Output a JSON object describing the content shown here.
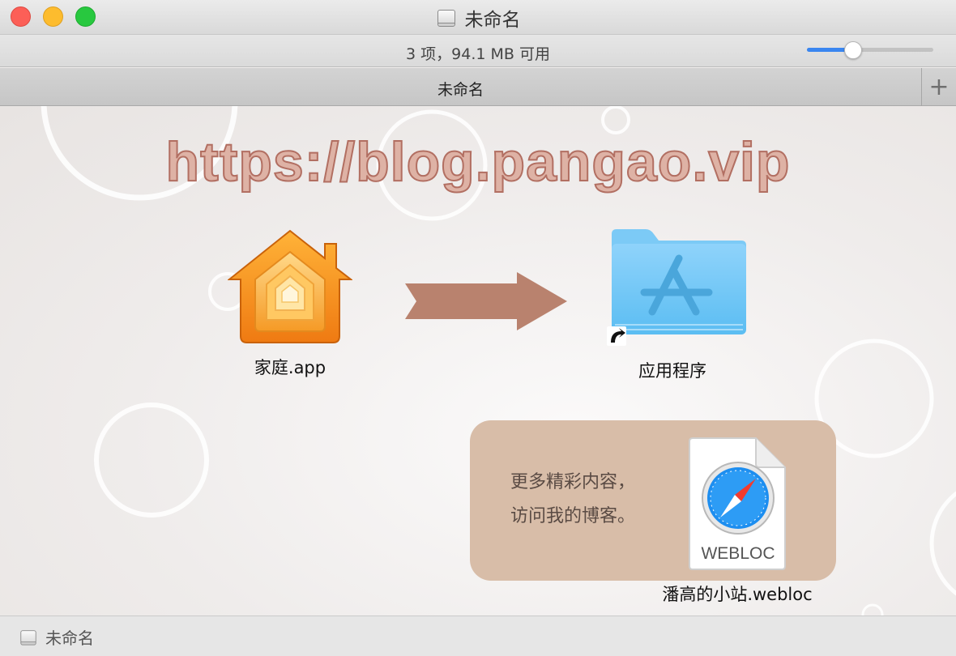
{
  "window": {
    "title": "未命名",
    "status": "3 项，94.1 MB 可用",
    "icon_size_level": 0.34
  },
  "tabs": [
    {
      "label": "未命名"
    }
  ],
  "tab_add": "+",
  "content": {
    "watermark": "https://blog.pangao.vip",
    "items": [
      {
        "name": "家庭.app",
        "icon": "home-app-icon"
      },
      {
        "name": "应用程序",
        "icon": "applications-folder-icon"
      },
      {
        "name": "潘高的小站.webloc",
        "icon": "webloc-file-icon",
        "badge": "WEBLOC"
      }
    ],
    "promo": {
      "line1": "更多精彩内容，",
      "line2": "访问我的博客。"
    }
  },
  "pathbar": {
    "label": "未命名",
    "icon": "disk-icon"
  },
  "colors": {
    "accent": "#3a86f0",
    "close": "#fc5f57",
    "minimize": "#fdbc2e",
    "zoom": "#28c83f",
    "arrow": "#b9826e",
    "promo_bg": "#d8bda8"
  }
}
